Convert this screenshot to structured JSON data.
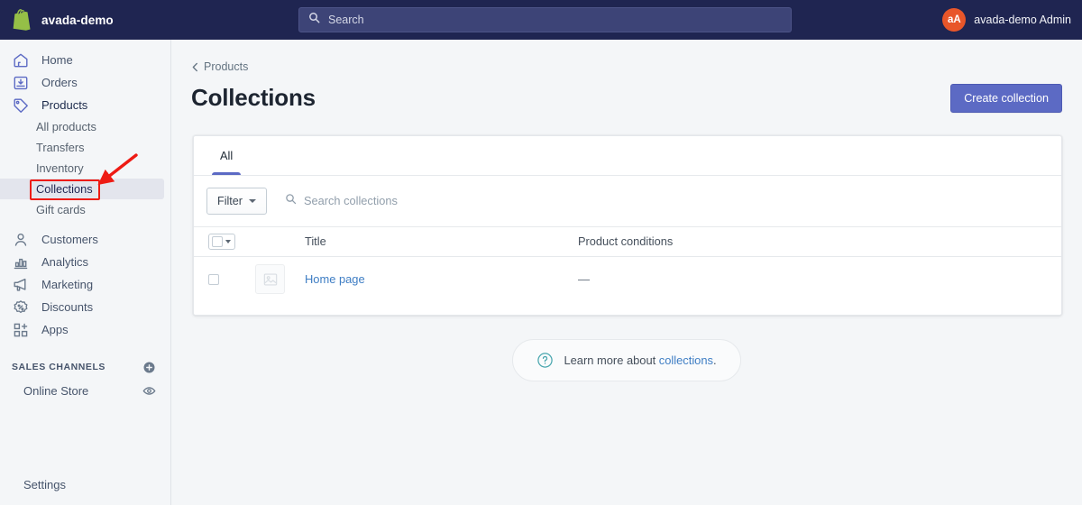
{
  "topbar": {
    "brand_name": "avada-demo",
    "logo_icon": "shopify-bag-icon",
    "search": {
      "placeholder": "Search",
      "icon": "search-icon"
    },
    "account": {
      "initials": "aA",
      "name": "avada-demo Admin"
    }
  },
  "sidebar": {
    "items": [
      {
        "label": "Home",
        "icon": "home-icon"
      },
      {
        "label": "Orders",
        "icon": "orders-inbox-icon"
      },
      {
        "label": "Products",
        "icon": "products-tag-icon"
      }
    ],
    "product_subitems": [
      {
        "label": "All products"
      },
      {
        "label": "Transfers"
      },
      {
        "label": "Inventory"
      },
      {
        "label": "Collections",
        "selected": true
      },
      {
        "label": "Gift cards"
      }
    ],
    "items_lower": [
      {
        "label": "Customers",
        "icon": "customers-person-icon"
      },
      {
        "label": "Analytics",
        "icon": "analytics-bars-icon"
      },
      {
        "label": "Marketing",
        "icon": "marketing-megaphone-icon"
      },
      {
        "label": "Discounts",
        "icon": "discounts-percent-icon"
      },
      {
        "label": "Apps",
        "icon": "apps-grid-plus-icon"
      }
    ],
    "sales_channels": {
      "title": "SALES CHANNELS",
      "add_icon": "plus-circle-icon",
      "channels": [
        {
          "label": "Online Store",
          "icon": "online-store-icon",
          "action_icon": "eye-icon"
        }
      ]
    },
    "settings": {
      "label": "Settings",
      "icon": "gear-icon"
    }
  },
  "main": {
    "breadcrumb": {
      "label": "Products",
      "icon": "chevron-left-icon"
    },
    "page_title": "Collections",
    "primary_button": "Create collection",
    "tabs": [
      {
        "label": "All",
        "active": true
      }
    ],
    "filter_button": "Filter",
    "search": {
      "placeholder": "Search collections",
      "icon": "search-icon"
    },
    "table": {
      "select_all_icon": "checkbox-dropdown-icon",
      "columns": [
        "Title",
        "Product conditions"
      ],
      "rows": [
        {
          "checkbox": false,
          "thumbnail_icon": "image-placeholder-icon",
          "title": "Home page",
          "product_conditions": "—"
        }
      ]
    },
    "footer_help": {
      "icon": "question-circle-icon",
      "text": "Learn more about ",
      "link": "collections",
      "suffix": "."
    }
  },
  "annotations": {
    "highlight_target": "Collections",
    "color": "#ee1b14"
  },
  "colors": {
    "topbar": "#1f2551",
    "accent": "#5c6ac4",
    "avatar": "#e8562a",
    "link": "#3f7ec4",
    "page_bg": "#f4f6f8",
    "annotation": "#ee1b14"
  }
}
